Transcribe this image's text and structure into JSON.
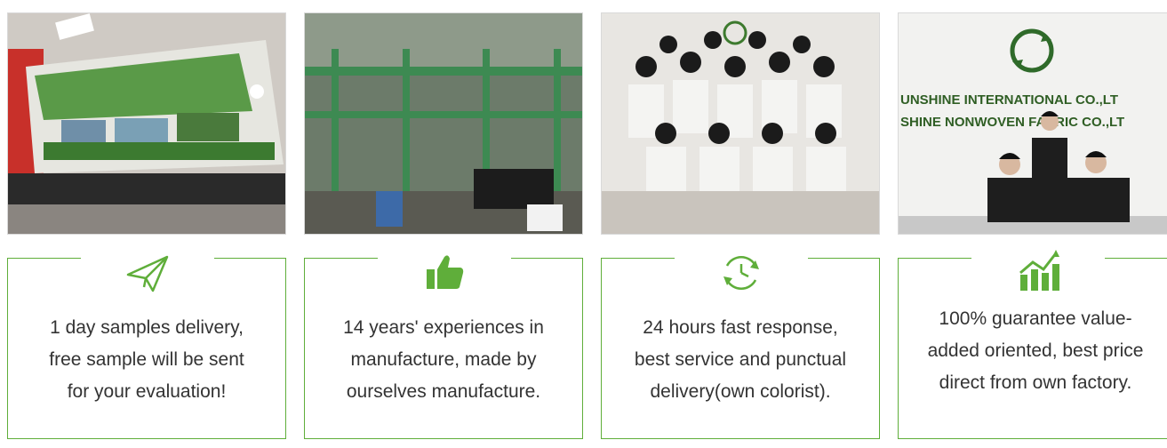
{
  "features": [
    {
      "photo": "packaged-fabric-samples",
      "icon": "paper-plane-icon",
      "text": "1 day samples delivery,\nfree sample will be sent\nfor your evaluation!"
    },
    {
      "photo": "factory-production-line",
      "icon": "thumbs-up-icon",
      "text": "14 years' experiences in\nmanufacture, made by\nourselves manufacture."
    },
    {
      "photo": "sales-team-group",
      "icon": "clock-refresh-icon",
      "text": "24 hours fast response,\nbest service and punctual\ndelivery(own colorist)."
    },
    {
      "photo": "company-management",
      "icon": "growth-chart-icon",
      "text": "100% guarantee value-\nadded oriented, best price\ndirect from own factory.",
      "sign_line_1": "UNSHINE INTERNATIONAL CO.,LT",
      "sign_line_2": "SHINE NONWOVEN FABRIC CO.,LT"
    }
  ],
  "colors": {
    "accent_green": "#5fae3a",
    "text": "#333333"
  }
}
